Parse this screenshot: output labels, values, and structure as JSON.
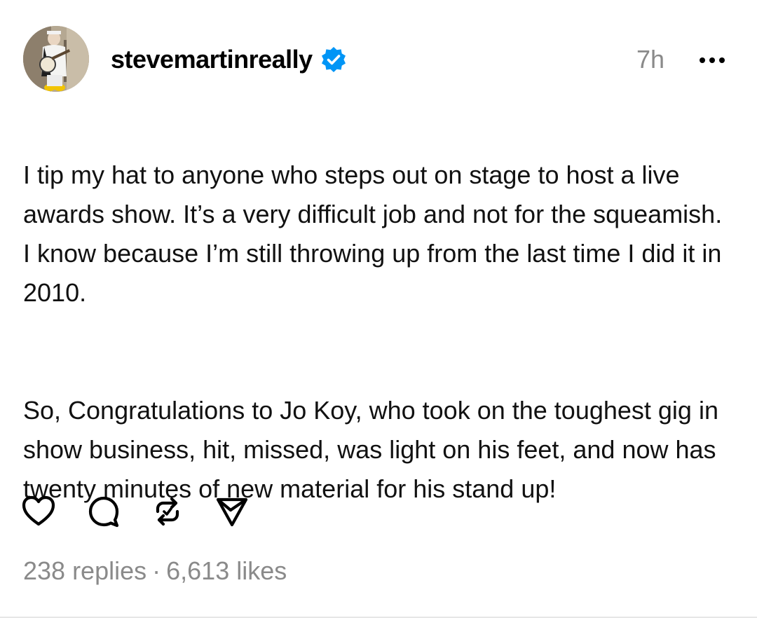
{
  "post": {
    "username": "stevemartinreally",
    "timestamp": "7h",
    "body_paragraphs": [
      "I tip my hat to anyone who steps out on stage to host a live awards show.  It’s a very difficult job and not for the squeamish. I know because I’m still throwing up from the last time I did it in 2010.",
      "So, Congratulations to Jo Koy, who took on the toughest gig in show business, hit, missed, was light on his feet, and now has twenty minutes of new material for his stand up!"
    ],
    "stats": {
      "replies": "238 replies",
      "separator": "·",
      "likes": "6,613 likes"
    },
    "icons": {
      "verified": "verified-badge-icon",
      "more": "more-options-icon",
      "like": "heart-icon",
      "reply": "comment-icon",
      "repost": "repost-icon",
      "share": "send-icon"
    },
    "colors": {
      "verified_blue": "#0095f6",
      "meta_gray": "#8a8a8a",
      "text": "#111111"
    }
  }
}
